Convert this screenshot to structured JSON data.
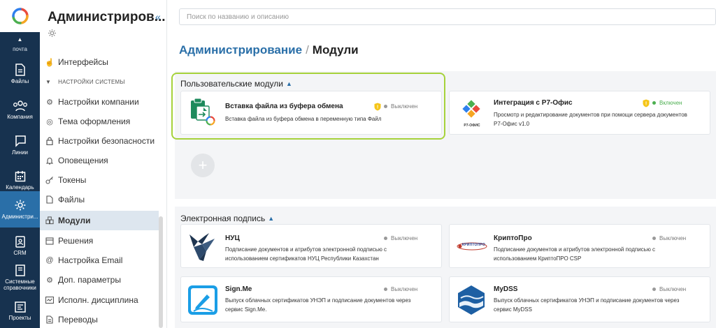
{
  "rail": {
    "partial_label": "почта",
    "items": [
      {
        "label": "Файлы",
        "icon": "file-icon"
      },
      {
        "label": "Компания",
        "icon": "people-icon"
      },
      {
        "label": "Линии",
        "icon": "chat-icon"
      },
      {
        "label": "Календарь",
        "icon": "calendar-icon"
      },
      {
        "label": "Администри...",
        "icon": "gear-icon"
      },
      {
        "label": "CRM",
        "icon": "crm-icon"
      },
      {
        "label": "Системные справочники",
        "icon": "book-icon"
      },
      {
        "label": "Проекты",
        "icon": "projects-icon"
      }
    ],
    "active_index": 4
  },
  "sidebar": {
    "title": "Администриров...",
    "section_label": "НАСТРОЙКИ СИСТЕМЫ",
    "items": [
      {
        "label": "Интерфейсы",
        "icon": "interface-icon"
      },
      {
        "label": "Настройки компании",
        "icon": "sliders-icon"
      },
      {
        "label": "Тема оформления",
        "icon": "palette-icon"
      },
      {
        "label": "Настройки безопасности",
        "icon": "lock-icon"
      },
      {
        "label": "Оповещения",
        "icon": "bell-icon"
      },
      {
        "label": "Токены",
        "icon": "key-icon"
      },
      {
        "label": "Файлы",
        "icon": "file-icon"
      },
      {
        "label": "Модули",
        "icon": "modules-icon"
      },
      {
        "label": "Решения",
        "icon": "solutions-icon"
      },
      {
        "label": "Настройка Email",
        "icon": "at-icon"
      },
      {
        "label": "Доп. параметры",
        "icon": "sliders-icon"
      },
      {
        "label": "Исполн. дисциплина",
        "icon": "discipline-icon"
      },
      {
        "label": "Переводы",
        "icon": "translate-icon"
      }
    ],
    "active_index": 7
  },
  "search": {
    "placeholder": "Поиск по названию и описанию",
    "value": ""
  },
  "breadcrumb": {
    "root": "Администрирование",
    "separator": "/",
    "current": "Модули"
  },
  "sections": [
    {
      "title": "Пользовательские модули",
      "cards": [
        {
          "name": "Вставка файла из буфера обмена",
          "description": "Вставка файла из буфера обмена в переменную типа Файл",
          "status": "Выключен",
          "enabled": false,
          "shield": true
        },
        {
          "name": "Интеграция с Р7-Офис",
          "description": "Просмотр и редактирование документов при помощи сервера документов Р7-Офис v1.0",
          "status": "Включен",
          "enabled": true,
          "shield": true
        }
      ]
    },
    {
      "title": "Электронная подпись",
      "cards": [
        {
          "name": "НУЦ",
          "description": "Подписание документов и атрибутов электронной подписью с использованием сертификатов НУЦ Республики Казахстан",
          "status": "Выключен",
          "enabled": false
        },
        {
          "name": "КриптоПро",
          "description": "Подписание документов и атрибутов электронной подписью с использованием КриптоПРО CSP",
          "status": "Выключен",
          "enabled": false
        },
        {
          "name": "Sign.Me",
          "description": "Выпуск облачных сертификатов УНЭП и подписание документов через сервис Sign.Me.",
          "status": "Выключен",
          "enabled": false
        },
        {
          "name": "MyDSS",
          "description": "Выпуск облачных сертификатов УНЭП и подписание документов через сервис MyDSS",
          "status": "Выключен",
          "enabled": false
        }
      ]
    }
  ],
  "logos": {
    "r7_caption": "Р7-ОФИС",
    "cryptopro_caption": "КРИПТОПРО"
  },
  "colors": {
    "accent": "#2a6fa8",
    "rail_bg": "#17324f",
    "highlight": "#a6d23b",
    "enabled": "#4caf50"
  }
}
